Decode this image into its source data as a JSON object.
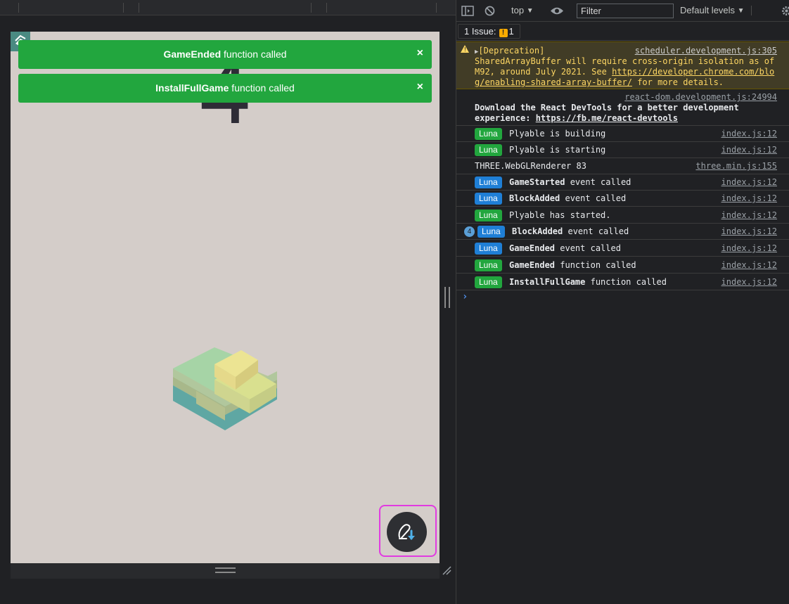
{
  "game": {
    "score": "4",
    "toasts": [
      {
        "name": "GameEnded",
        "suffix": " function called",
        "close": "×"
      },
      {
        "name": "InstallFullGame",
        "suffix": " function called",
        "close": "×"
      }
    ]
  },
  "devtools": {
    "context": "top",
    "filter_placeholder": "Filter",
    "levels": "Default levels",
    "issues_label": "1 Issue:",
    "issues_count": "1",
    "warning": {
      "line1": "[Deprecation]",
      "source": "scheduler.development.js:305",
      "line2": "SharedArrayBuffer will require cross-origin isolation as of",
      "line3a": "M92, around July 2021. See ",
      "line3b": "https://developer.chrome.com/blo",
      "line4a": "g/enabling-shared-array-buffer/",
      "line4b": " for more details."
    },
    "react": {
      "source": "react-dom.development.js:24994",
      "line1": "Download the React DevTools for a better development",
      "line2a": "experience: ",
      "line2b": "https://fb.me/react-devtools"
    },
    "rows": [
      {
        "badge": "Luna",
        "color": "green",
        "bold": "",
        "text": "Plyable is building",
        "source": "index.js:12"
      },
      {
        "badge": "Luna",
        "color": "green",
        "bold": "",
        "text": "Plyable is starting",
        "source": "index.js:12"
      },
      {
        "badge": "",
        "color": "",
        "bold": "",
        "text": "THREE.WebGLRenderer 83",
        "source": "three.min.js:155"
      },
      {
        "badge": "Luna",
        "color": "blue",
        "bold": "GameStarted",
        "text": " event called",
        "source": "index.js:12"
      },
      {
        "badge": "Luna",
        "color": "blue",
        "bold": "BlockAdded",
        "text": " event called",
        "source": "index.js:12"
      },
      {
        "badge": "Luna",
        "color": "green",
        "bold": "",
        "text": "Plyable has started.",
        "source": "index.js:12"
      },
      {
        "badge": "Luna",
        "color": "blue",
        "bold": "BlockAdded",
        "text": " event called",
        "source": "index.js:12",
        "count": "4"
      },
      {
        "badge": "Luna",
        "color": "blue",
        "bold": "GameEnded",
        "text": " event called",
        "source": "index.js:12"
      },
      {
        "badge": "Luna",
        "color": "green",
        "bold": "GameEnded",
        "text": " function called",
        "source": "index.js:12"
      },
      {
        "badge": "Luna",
        "color": "green",
        "bold": "InstallFullGame",
        "text": " function called",
        "source": "index.js:12"
      }
    ],
    "prompt": "›"
  }
}
